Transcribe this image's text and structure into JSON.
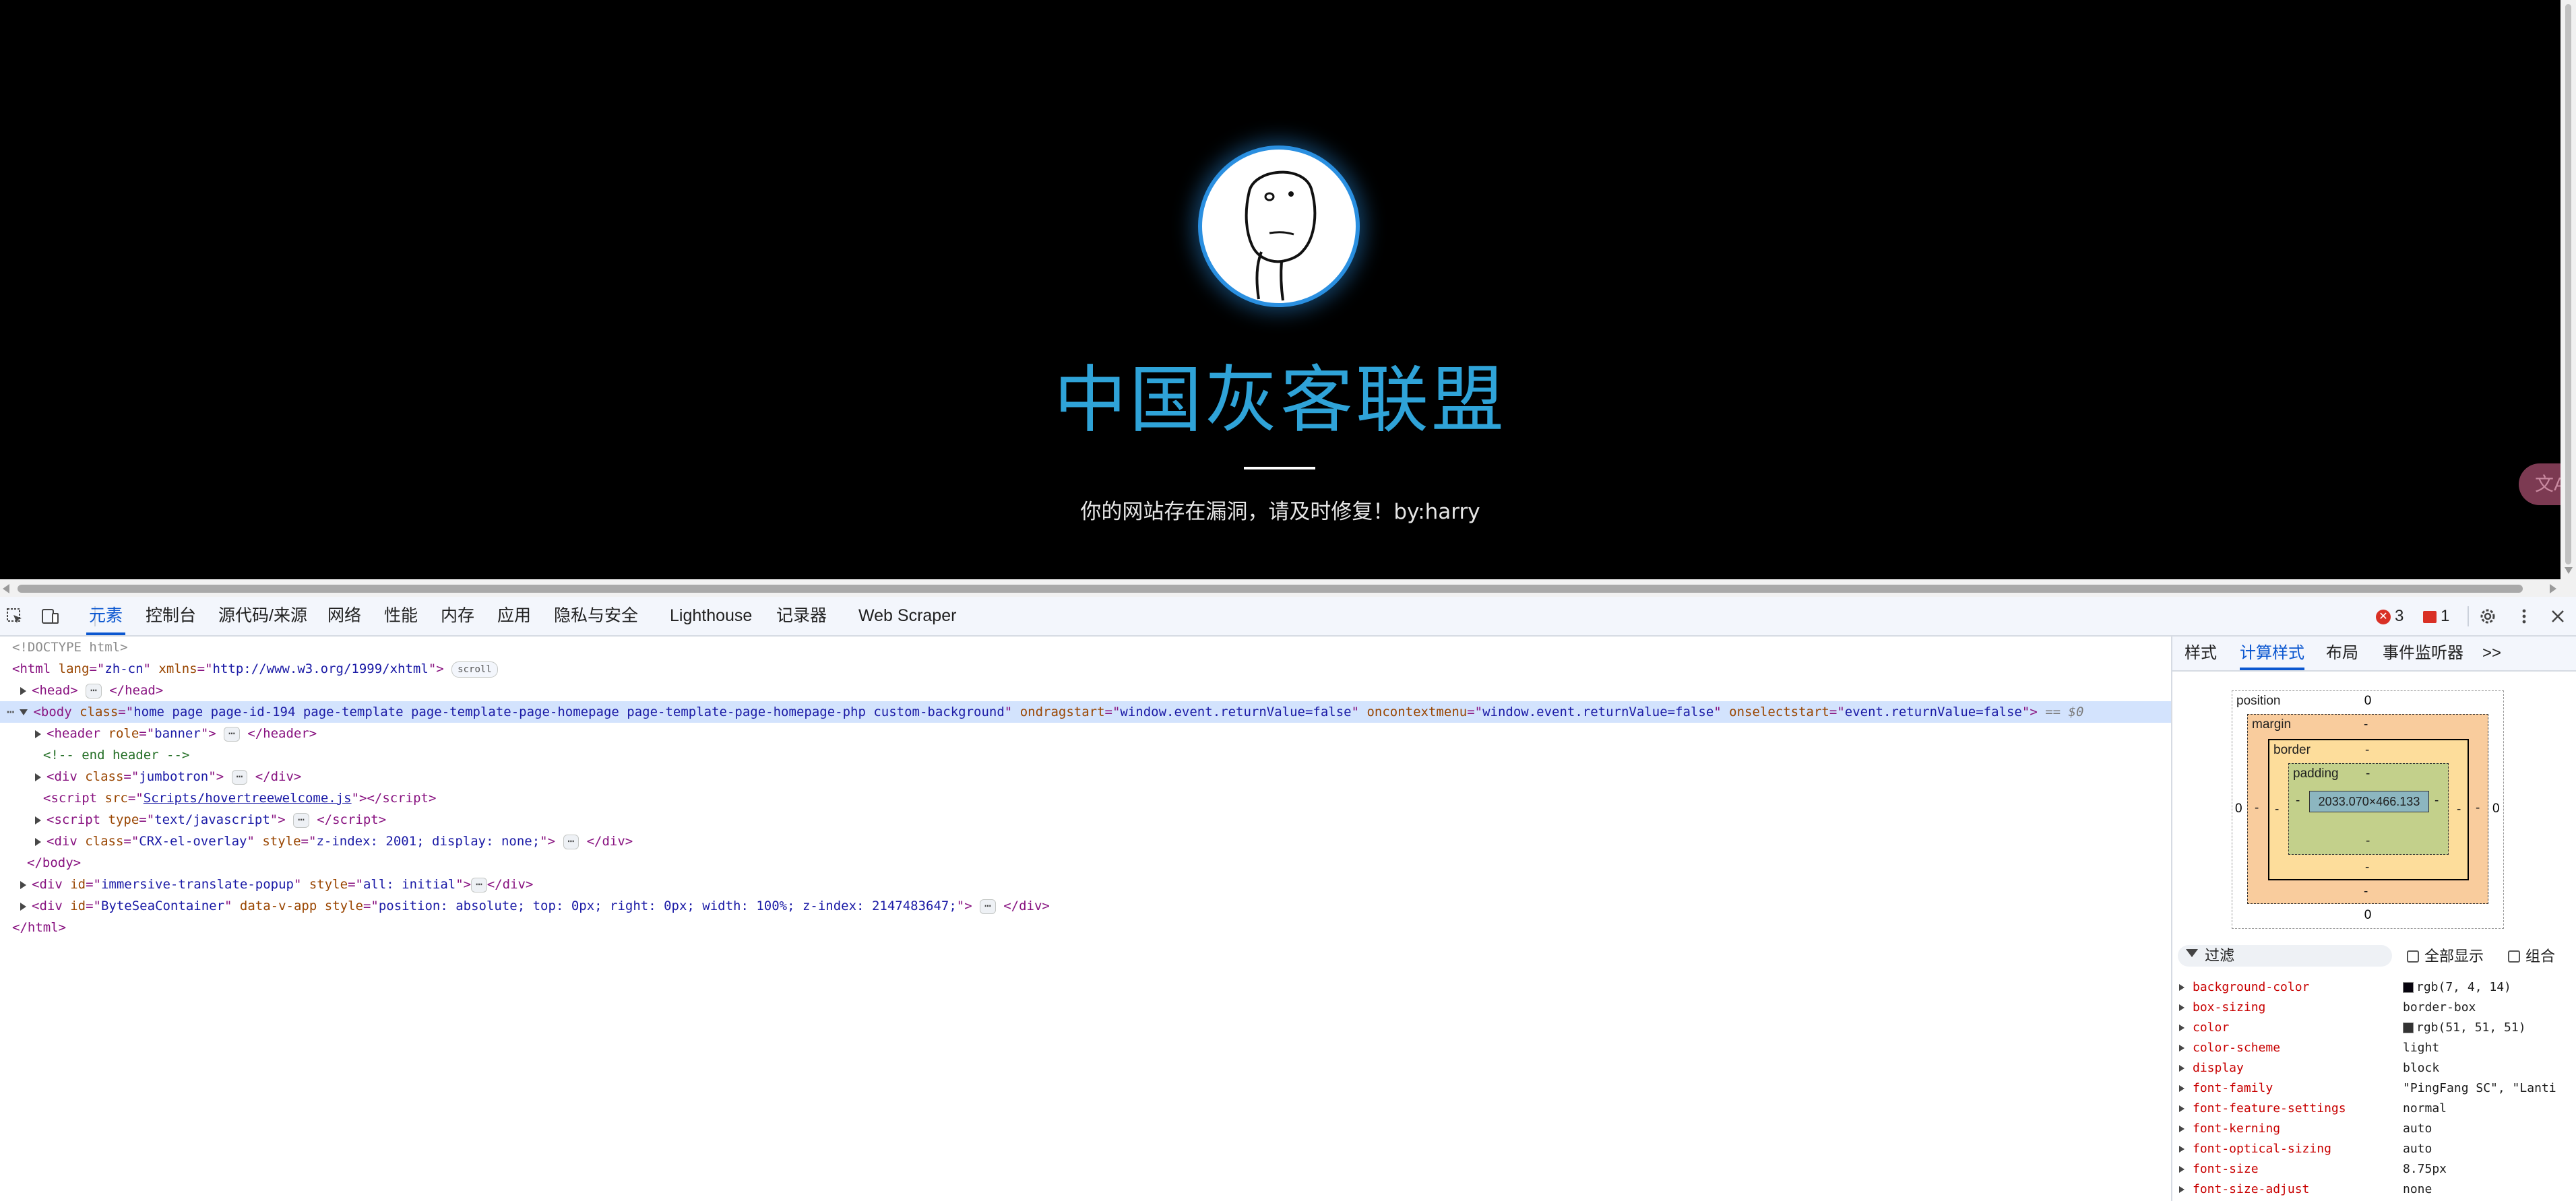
{
  "page": {
    "site_title": "中国灰客联盟",
    "site_subtitle": "你的网站存在漏洞，请及时修复！by:harry",
    "translate_fab_label": "文A"
  },
  "devtools": {
    "tabs": [
      "元素",
      "控制台",
      "源代码/来源",
      "网络",
      "性能",
      "内存",
      "应用",
      "隐私与安全",
      "Lighthouse",
      "记录器",
      "Web Scraper"
    ],
    "active_tab": "元素",
    "error_count": "3",
    "warning_count": "1",
    "elements": {
      "doctype": "<!DOCTYPE html>",
      "html_open": {
        "tag": "html",
        "lang": "zh-cn",
        "xmlns": "http://www.w3.org/1999/xhtml",
        "badge": "scroll"
      },
      "head": {
        "tag": "head"
      },
      "body": {
        "class": "home page page-id-194 page-template page-template-page-homepage page-template-page-homepage-php custom-background",
        "ondragstart": "window.event.returnValue=false",
        "oncontextmenu": "window.event.returnValue=false",
        "onselectstart": "event.returnValue=false",
        "eq": "== $0"
      },
      "header": {
        "role": "banner"
      },
      "comment": "<!-- end header -->",
      "jumbotron": {
        "class": "jumbotron"
      },
      "script1_src": "Scripts/hovertreewelcome.js",
      "script2_type": "text/javascript",
      "crx_div": {
        "class": "CRX-el-overlay",
        "style": "z-index: 2001; display: none;"
      },
      "immersive_div": {
        "id": "immersive-translate-popup",
        "style": "all: initial"
      },
      "bytesea_div": {
        "id": "ByteSeaContainer",
        "attr": "data-v-app",
        "style": "position: absolute; top: 0px; right: 0px; width: 100%; z-index: 2147483647;"
      }
    },
    "sidebar": {
      "tabs": [
        "样式",
        "计算样式",
        "布局",
        "事件监听器"
      ],
      "active_tab": "计算样式",
      "more_label": ">>",
      "box_model": {
        "position_label": "position",
        "position_top": "0",
        "position_bottom": "0",
        "position_left": "0",
        "position_right": "0",
        "margin_label": "margin",
        "border_label": "border",
        "padding_label": "padding",
        "dash": "-",
        "content_size": "2033.070×466.133"
      },
      "filter_label": "过滤",
      "show_all_label": "全部显示",
      "group_label": "组合",
      "computed": [
        {
          "name": "background-color",
          "value": "rgb(7, 4, 14)",
          "swatch": "#07040e"
        },
        {
          "name": "box-sizing",
          "value": "border-box"
        },
        {
          "name": "color",
          "value": "rgb(51, 51, 51)",
          "swatch": "#333333"
        },
        {
          "name": "color-scheme",
          "value": "light"
        },
        {
          "name": "display",
          "value": "block"
        },
        {
          "name": "font-family",
          "value": "\"PingFang SC\", \"Lanti"
        },
        {
          "name": "font-feature-settings",
          "value": "normal"
        },
        {
          "name": "font-kerning",
          "value": "auto"
        },
        {
          "name": "font-optical-sizing",
          "value": "auto"
        },
        {
          "name": "font-size",
          "value": "8.75px"
        },
        {
          "name": "font-size-adjust",
          "value": "none"
        }
      ]
    }
  }
}
